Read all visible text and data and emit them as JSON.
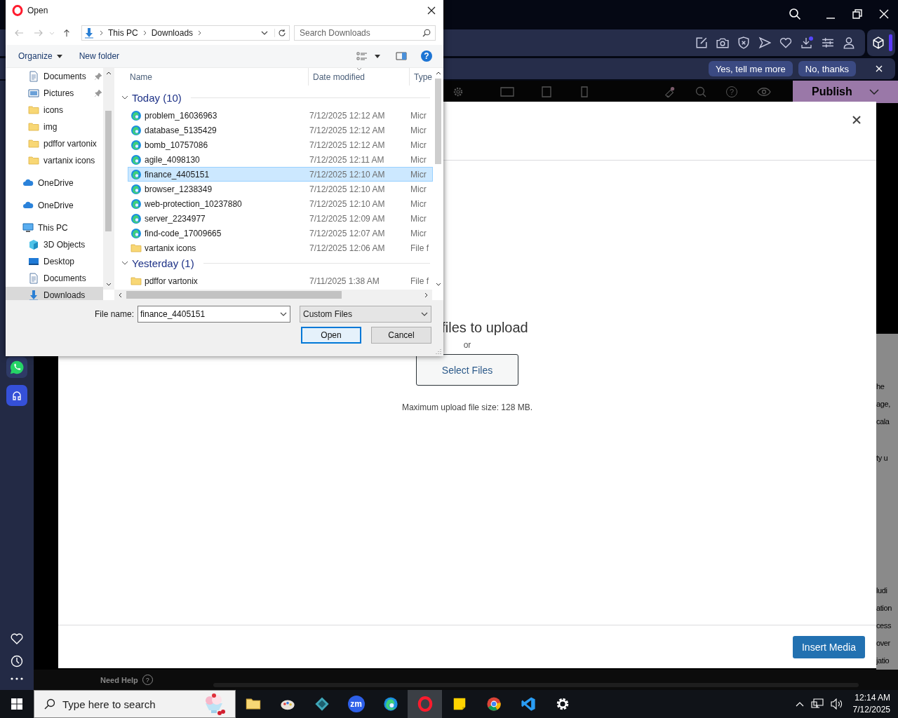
{
  "browser": {
    "notification": {
      "buttons": [
        "Yes, tell me more",
        "No, thanks"
      ]
    },
    "editor": {
      "publish": "Publish",
      "help_glyph": "?",
      "need_help": "Need Help",
      "need_help_glyph": "?"
    },
    "side_panel_paragraphs": [
      [
        "he",
        "age,",
        "cala"
      ],
      [
        "ty u"
      ],
      [
        "ludi",
        "ation",
        "cess",
        "over",
        "jatio"
      ]
    ]
  },
  "media_modal": {
    "drop_text": "files to upload",
    "or": "or",
    "select_button": "Select Files",
    "max_size": "Maximum upload file size: 128 MB.",
    "insert_button": "Insert Media"
  },
  "dialog": {
    "title": "Open",
    "path": [
      "This PC",
      "Downloads"
    ],
    "search_placeholder": "Search Downloads",
    "commands": [
      "Organize",
      "New folder"
    ],
    "help_glyph": "?",
    "quick_access": [
      {
        "label": "Documents",
        "kind": "document",
        "pinned": true,
        "selected": false
      },
      {
        "label": "Pictures",
        "kind": "pictures",
        "pinned": true,
        "selected": false
      },
      {
        "label": "icons",
        "kind": "folder",
        "pinned": false,
        "selected": false
      },
      {
        "label": "img",
        "kind": "folder",
        "pinned": false,
        "selected": false
      },
      {
        "label": "pdffor vartonix",
        "kind": "folder",
        "pinned": false,
        "selected": false
      },
      {
        "label": "vartanix icons",
        "kind": "folder",
        "pinned": false,
        "selected": false
      }
    ],
    "nav": [
      {
        "label": "OneDrive",
        "kind": "cloud",
        "selected": false
      },
      {
        "label": "OneDrive",
        "kind": "cloud",
        "selected": false
      },
      {
        "label": "This PC",
        "kind": "pc",
        "selected": false,
        "children": [
          {
            "label": "3D Objects",
            "kind": "cube",
            "selected": false
          },
          {
            "label": "Desktop",
            "kind": "desktop",
            "selected": false
          },
          {
            "label": "Documents",
            "kind": "document",
            "selected": false
          },
          {
            "label": "Downloads",
            "kind": "download",
            "selected": true
          }
        ]
      }
    ],
    "columns": [
      "Name",
      "Date modified",
      "Type"
    ],
    "groups": [
      {
        "label": "Today (10)",
        "expanded": true,
        "rows": [
          {
            "name": "problem_16036963",
            "date": "7/12/2025 12:12 AM",
            "type": "Micr",
            "kind": "edge",
            "selected": false
          },
          {
            "name": "database_5135429",
            "date": "7/12/2025 12:12 AM",
            "type": "Micr",
            "kind": "edge",
            "selected": false
          },
          {
            "name": "bomb_10757086",
            "date": "7/12/2025 12:12 AM",
            "type": "Micr",
            "kind": "edge",
            "selected": false
          },
          {
            "name": "agile_4098130",
            "date": "7/12/2025 12:11 AM",
            "type": "Micr",
            "kind": "edge",
            "selected": false
          },
          {
            "name": "finance_4405151",
            "date": "7/12/2025 12:10 AM",
            "type": "Micr",
            "kind": "edge",
            "selected": true
          },
          {
            "name": "browser_1238349",
            "date": "7/12/2025 12:10 AM",
            "type": "Micr",
            "kind": "edge",
            "selected": false
          },
          {
            "name": "web-protection_10237880",
            "date": "7/12/2025 12:10 AM",
            "type": "Micr",
            "kind": "edge",
            "selected": false
          },
          {
            "name": "server_2234977",
            "date": "7/12/2025 12:09 AM",
            "type": "Micr",
            "kind": "edge",
            "selected": false
          },
          {
            "name": "find-code_17009665",
            "date": "7/12/2025 12:07 AM",
            "type": "Micr",
            "kind": "edge",
            "selected": false
          },
          {
            "name": "vartanix icons",
            "date": "7/12/2025 12:06 AM",
            "type": "File f",
            "kind": "folder",
            "selected": false
          }
        ]
      },
      {
        "label": "Yesterday (1)",
        "expanded": true,
        "rows": [
          {
            "name": "pdffor vartonix",
            "date": "7/11/2025 1:38 AM",
            "type": "File f",
            "kind": "folder",
            "selected": false
          }
        ]
      }
    ],
    "file_name_label": "File name:",
    "file_name": "finance_4405151",
    "filter": "Custom Files",
    "buttons": [
      {
        "label": "Open",
        "default": true
      },
      {
        "label": "Cancel",
        "default": false
      }
    ]
  },
  "taskbar": {
    "search_placeholder": "Type here to search",
    "apps": [
      {
        "kind": "explorer",
        "active": false
      },
      {
        "kind": "paint",
        "active": false
      },
      {
        "kind": "diamond",
        "active": false
      },
      {
        "kind": "zoom",
        "label": "zm",
        "active": false
      },
      {
        "kind": "edge",
        "active": false
      },
      {
        "kind": "opera",
        "active": true
      },
      {
        "kind": "notes",
        "active": false
      },
      {
        "kind": "chrome",
        "active": false
      },
      {
        "kind": "vscode",
        "active": false
      },
      {
        "kind": "settings",
        "active": false
      }
    ],
    "time": "12:14 AM",
    "date": "7/12/2025"
  }
}
